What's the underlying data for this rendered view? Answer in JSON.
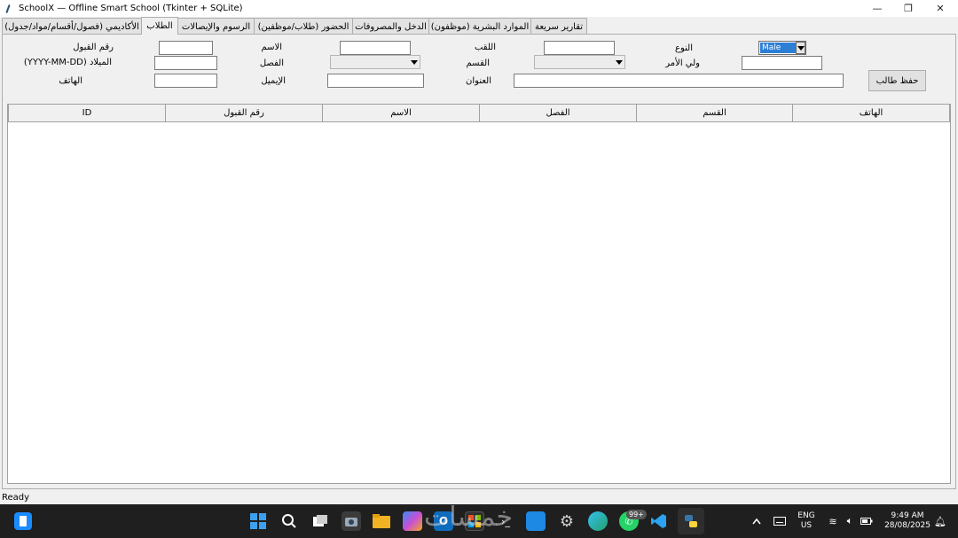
{
  "window": {
    "title": "SchoolX — Offline Smart School (Tkinter + SQLite)",
    "minimize_glyph": "—",
    "restore_glyph": "❐",
    "close_glyph": "✕"
  },
  "tabs": [
    {
      "label": "الأكاديمي (فصول/أقسام/مواد/جدول)"
    },
    {
      "label": "الطلاب"
    },
    {
      "label": "الرسوم والإيصالات"
    },
    {
      "label": "الحضور (طلاب/موظفين)"
    },
    {
      "label": "الدخل والمصروفات"
    },
    {
      "label": "الموارد البشرية (موظفون)"
    },
    {
      "label": "تقارير سريعة"
    }
  ],
  "active_tab": "الطلاب",
  "form": {
    "admission_no_label": "رقم القبول",
    "name_label": "الاسم",
    "surname_label": "اللقب",
    "gender_label": "النوع",
    "gender_value": "Male",
    "dob_label": "الميلاد (YYYY-MM-DD)",
    "class_label": "الفصل",
    "section_label": "القسم",
    "guardian_label": "ولي الأمر",
    "phone_label": "الهاتف",
    "email_label": "الإيميل",
    "address_label": "العنوان",
    "save_label": "حفظ طالب"
  },
  "table": {
    "columns": [
      "ID",
      "رقم القبول",
      "الاسم",
      "الفصل",
      "القسم",
      "الهاتف"
    ],
    "rows": []
  },
  "status": "Ready",
  "taskbar": {
    "lang_line1": "ENG",
    "lang_line2": "US",
    "time": "9:49 AM",
    "date": "28/08/2025",
    "whatsapp_badge": "99+",
    "watermark": "خمسات"
  }
}
